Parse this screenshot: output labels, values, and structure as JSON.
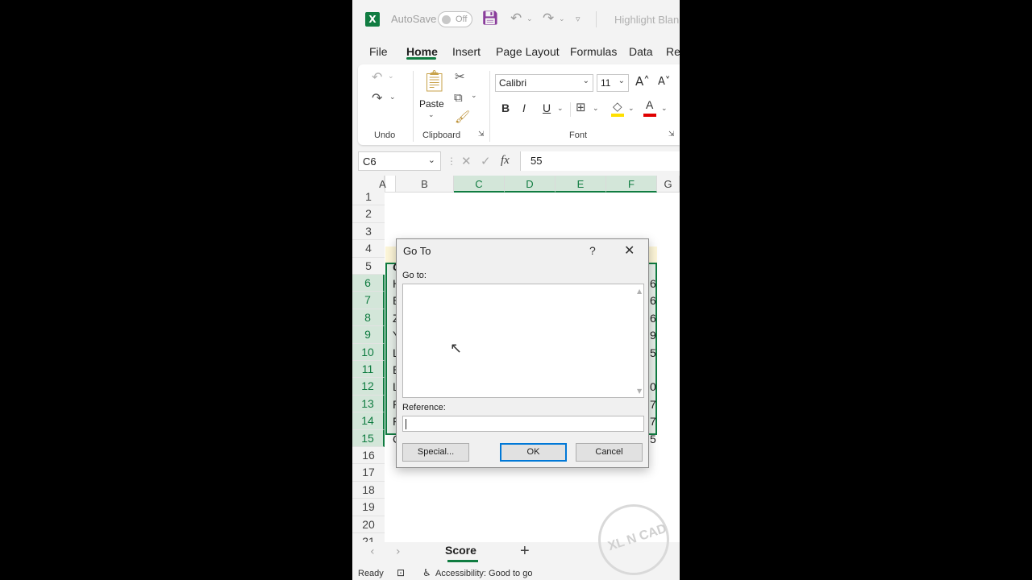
{
  "titlebar": {
    "autosave_label": "AutoSave",
    "autosave_state": "Off",
    "doc_title": "Highlight Blank"
  },
  "tabs": [
    "File",
    "Home",
    "Insert",
    "Page Layout",
    "Formulas",
    "Data",
    "Re"
  ],
  "ribbon": {
    "undo_label": "Undo",
    "clipboard_label": "Clipboard",
    "paste_label": "Paste",
    "font_label": "Font",
    "font_name": "Calibri",
    "font_size": "11",
    "bold": "B",
    "italic": "I",
    "underline": "U"
  },
  "formula_bar": {
    "name_box": "C6",
    "fx": "fx",
    "value": "55"
  },
  "grid": {
    "columns": [
      "A",
      "B",
      "C",
      "D",
      "E",
      "F",
      "G"
    ],
    "rows": [
      "1",
      "2",
      "3",
      "4",
      "5",
      "6",
      "7",
      "8",
      "9",
      "10",
      "11",
      "12",
      "13",
      "14",
      "15",
      "16",
      "17",
      "18",
      "19",
      "20",
      "21"
    ],
    "col_b_partial": [
      "C",
      "H",
      "E",
      "Z",
      "Y",
      "L",
      "E",
      "L",
      "P",
      "F",
      "C"
    ],
    "col_f_partial": [
      "6",
      "6",
      "6",
      "9",
      "5",
      "",
      "0",
      "7",
      "7",
      "5"
    ]
  },
  "sheet": {
    "tab_name": "Score",
    "add": "+"
  },
  "status": {
    "ready": "Ready",
    "accessibility": "Accessibility: Good to go"
  },
  "dialog": {
    "title": "Go To",
    "help": "?",
    "goto_label": "Go to:",
    "reference_label": "Reference:",
    "special_button": "Special...",
    "ok_button": "OK",
    "cancel_button": "Cancel"
  },
  "watermark": "XL N CAD",
  "colors": {
    "accent": "#107c41",
    "dialog_focus": "#0078d7"
  }
}
